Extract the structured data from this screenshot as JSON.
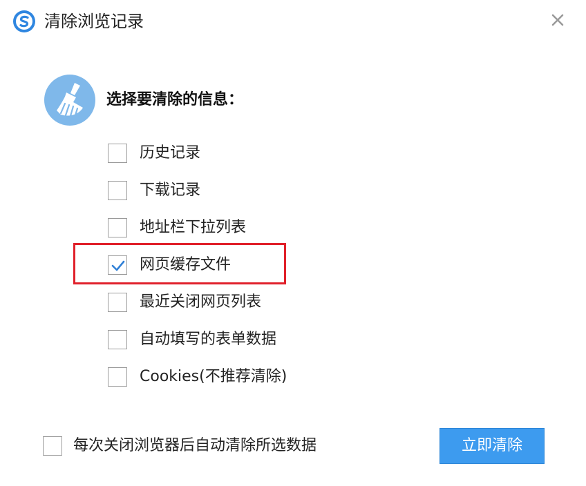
{
  "window": {
    "title": "清除浏览记录",
    "app_icon": "sogou-browser-icon",
    "close_icon": "close-icon"
  },
  "header": {
    "icon": "broom-icon",
    "heading": "选择要清除的信息："
  },
  "options": [
    {
      "label": "历史记录",
      "checked": false
    },
    {
      "label": "下载记录",
      "checked": false
    },
    {
      "label": "地址栏下拉列表",
      "checked": false
    },
    {
      "label": "网页缓存文件",
      "checked": true
    },
    {
      "label": "最近关闭网页列表",
      "checked": false
    },
    {
      "label": "自动填写的表单数据",
      "checked": false
    },
    {
      "label": "Cookies(不推荐清除)",
      "checked": false
    }
  ],
  "footer": {
    "auto_clear_label": "每次关闭浏览器后自动清除所选数据",
    "auto_clear_checked": false,
    "clear_button_label": "立即清除"
  },
  "colors": {
    "accent": "#3d9bef",
    "highlight": "#e0202a",
    "check": "#2f7fd6",
    "icon_circle": "#7fb8ea"
  }
}
